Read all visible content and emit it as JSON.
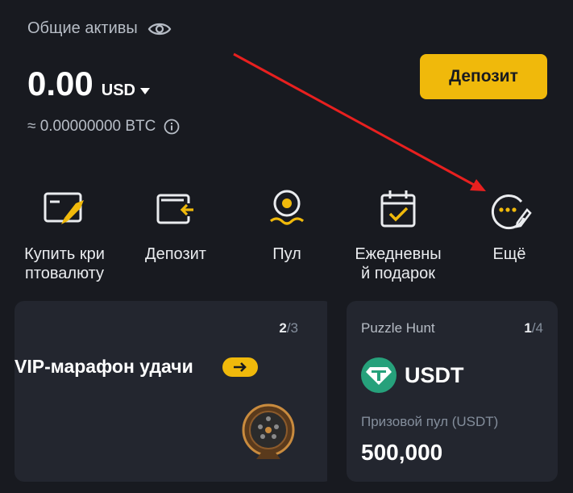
{
  "header": {
    "total_assets_label": "Общие активы",
    "balance": "0.00",
    "currency": "USD",
    "btc_equivalent": "≈ 0.00000000 BTC",
    "deposit_button": "Депозит"
  },
  "actions": [
    {
      "label": "Купить кри\nптовалюту",
      "icon": "rocket-icon"
    },
    {
      "label": "Депозит",
      "icon": "wallet-deposit-icon"
    },
    {
      "label": "Пул",
      "icon": "pool-icon"
    },
    {
      "label": "Ежедневны\nй подарок",
      "icon": "calendar-check-icon"
    },
    {
      "label": "Ещё",
      "icon": "more-icon"
    }
  ],
  "cards": {
    "vip": {
      "page_current": "2",
      "page_total": "/3",
      "title": "VIP-марафон удачи"
    },
    "puzzle": {
      "title": "Puzzle Hunt",
      "page_current": "1",
      "page_total": "/4",
      "token": "USDT",
      "prize_label": "Призовой пул (USDT)",
      "prize_value": "500,000"
    }
  },
  "colors": {
    "background": "#181a20",
    "card": "#23262f",
    "accent": "#f0b90b",
    "tether": "#26a17b",
    "annotation_arrow": "#e8201f"
  }
}
